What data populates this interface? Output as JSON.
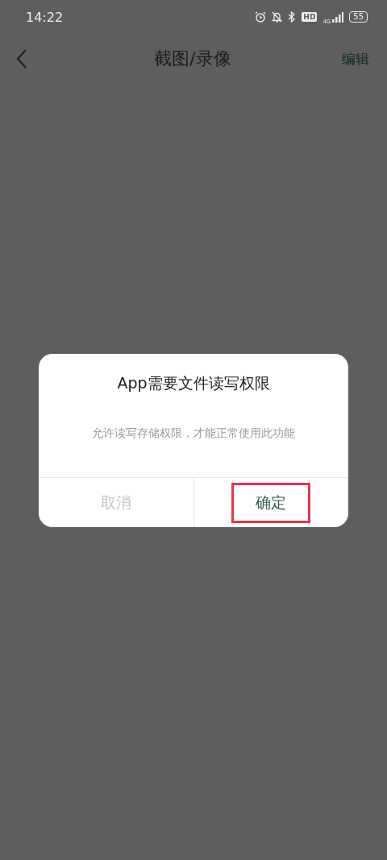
{
  "status_bar": {
    "time": "14:22",
    "network": "4G",
    "hd": "HD",
    "battery": "55"
  },
  "header": {
    "title": "截图/录像",
    "action": "编辑"
  },
  "dialog": {
    "title": "App需要文件读写权限",
    "message": "允许读写存储权限，才能正常使用此功能",
    "buttons": [
      {
        "label": "取消",
        "kind": "cancel",
        "highlighted": false
      },
      {
        "label": "确定",
        "kind": "confirm",
        "highlighted": true
      }
    ]
  }
}
